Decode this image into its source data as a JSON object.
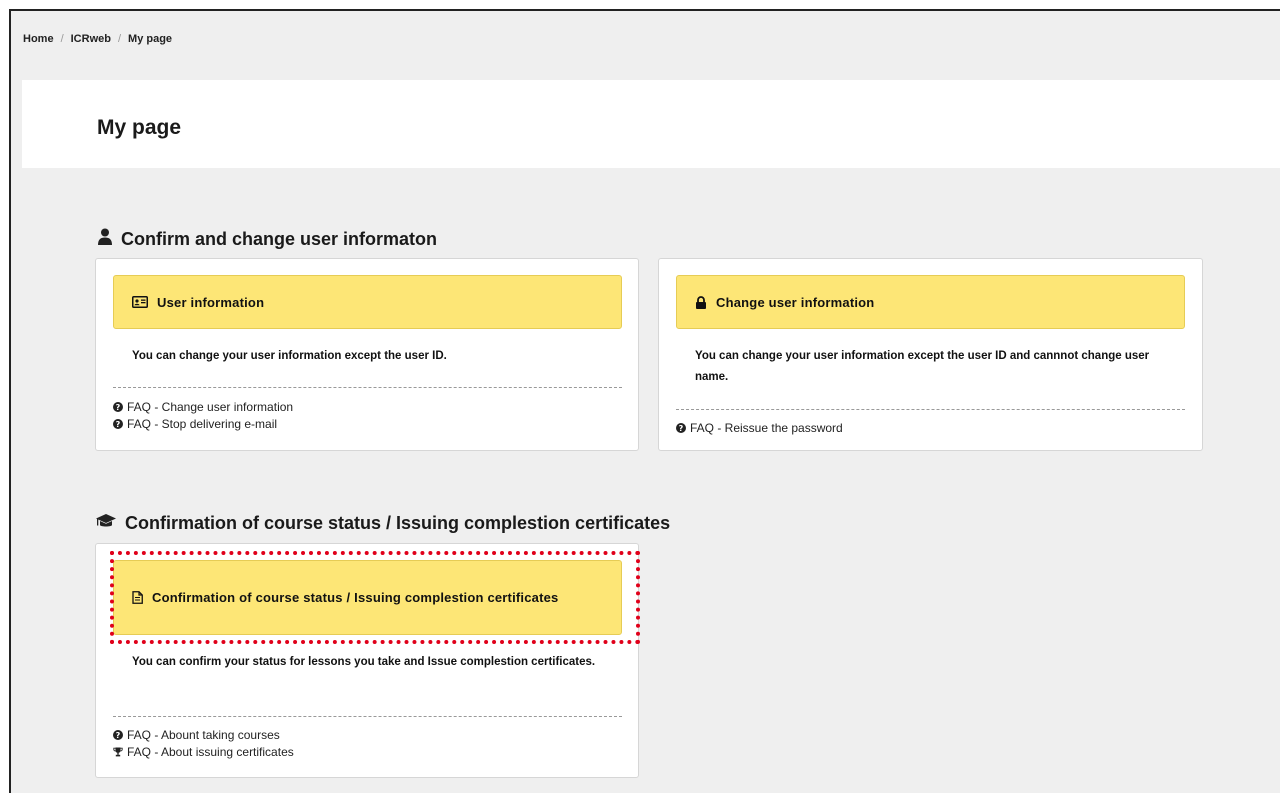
{
  "breadcrumb": [
    "Home",
    "ICRweb",
    "My page"
  ],
  "page_title": "My page",
  "sections": {
    "user_info": {
      "heading": "Confirm and change user informaton"
    },
    "course": {
      "heading": "Confirmation of course status / Issuing complestion certificates"
    }
  },
  "cards": {
    "user_information": {
      "title": "User information",
      "description": "You can change your user information except the user ID.",
      "faq": [
        "FAQ - Change user information",
        "FAQ - Stop delivering e-mail"
      ]
    },
    "change_user_information": {
      "title": "Change user information",
      "description": "You can change your user information except the user ID and cannnot change user name.",
      "faq": [
        "FAQ - Reissue the password"
      ]
    },
    "course_status": {
      "title": "Confirmation of course status / Issuing complestion certificates",
      "description": "You can confirm your status for lessons you take and Issue complestion certificates.",
      "faq": [
        "FAQ - Abount taking courses",
        "FAQ - About issuing certificates"
      ]
    }
  },
  "colors": {
    "card_header_bg": "#fde676",
    "highlight_border": "#e0001a",
    "page_bg": "#efefef"
  }
}
